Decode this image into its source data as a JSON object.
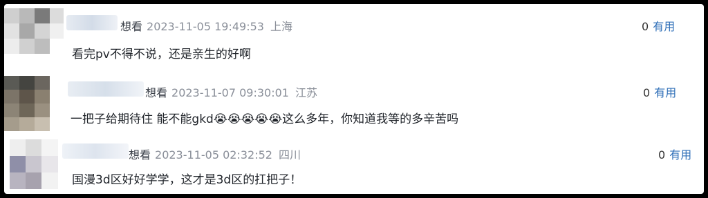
{
  "comments": [
    {
      "status": "想看",
      "time": "2023-11-05 19:49:53",
      "location": "上海",
      "text": "看完pv不得不说，还是亲生的好啊",
      "useful_count": "0",
      "useful_label": "有用"
    },
    {
      "status": "想看",
      "time": "2023-11-07 09:30:01",
      "location": "江苏",
      "text": "一把子给期待住 能不能gkd😭😭😭😭😭这么多年，你知道我等的多辛苦吗",
      "useful_count": "0",
      "useful_label": "有用"
    },
    {
      "status": "想看",
      "time": "2023-11-05 02:32:52",
      "location": "四川",
      "text": "国漫3d区好好学学，这才是3d区的扛把子！",
      "useful_count": "0",
      "useful_label": "有用"
    }
  ],
  "colors": {
    "link": "#2f6fb8",
    "meta": "#8a8f99"
  }
}
